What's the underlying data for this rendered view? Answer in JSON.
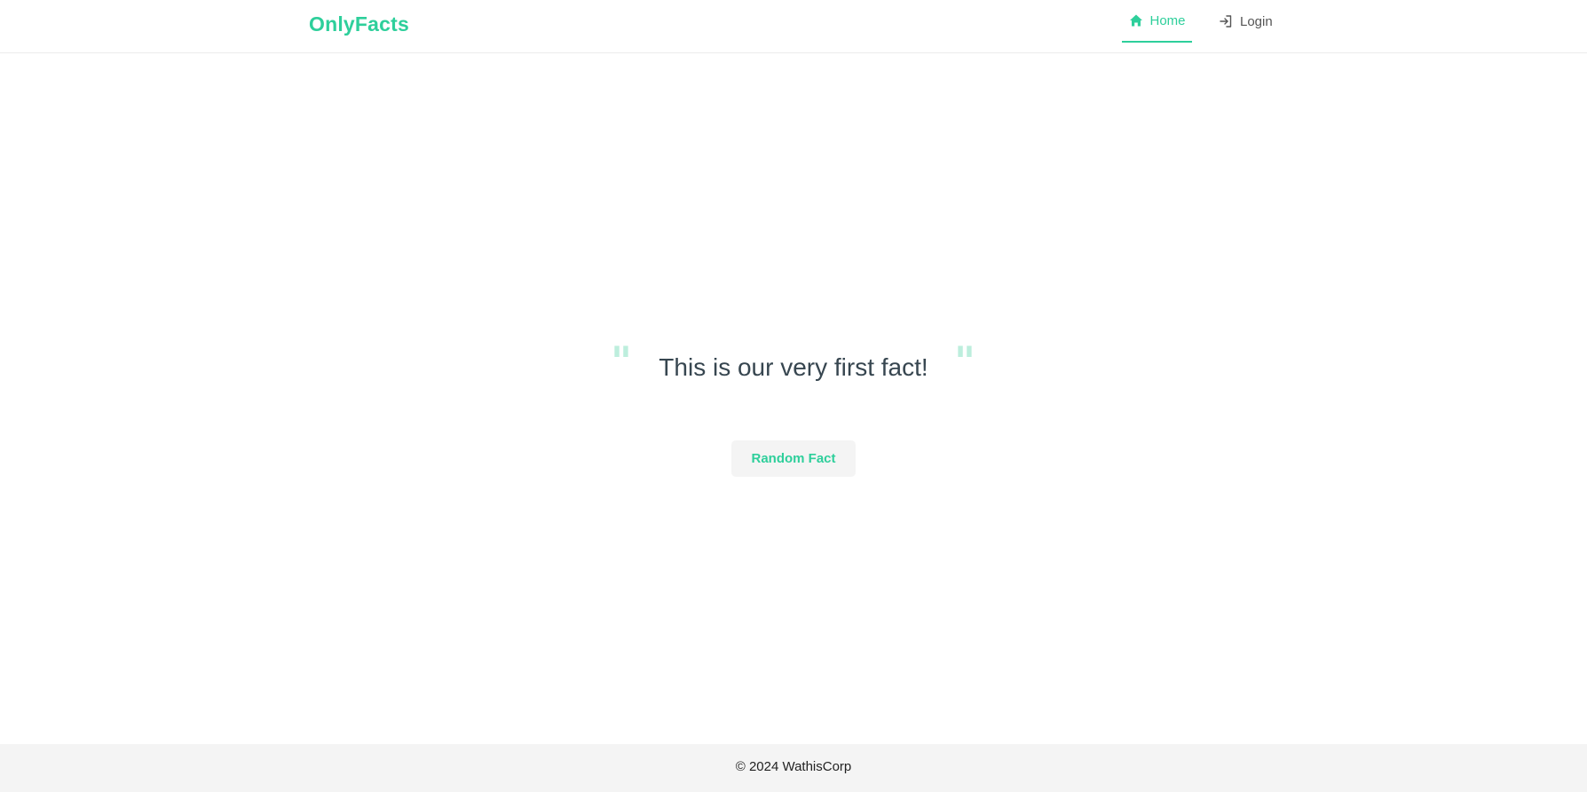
{
  "header": {
    "brand": "OnlyFacts",
    "nav": [
      {
        "label": "Home",
        "icon": "home-icon",
        "active": true
      },
      {
        "label": "Login",
        "icon": "login-icon",
        "active": false
      }
    ]
  },
  "main": {
    "fact": "This is our very first fact!",
    "open_quote": "\"",
    "close_quote": "\"",
    "button_label": "Random Fact"
  },
  "footer": {
    "text": "© 2024 WathisCorp"
  },
  "colors": {
    "accent": "#2ecf9b",
    "quote": "#bdeedd",
    "text": "#374650",
    "footer_bg": "#f4f4f4"
  }
}
